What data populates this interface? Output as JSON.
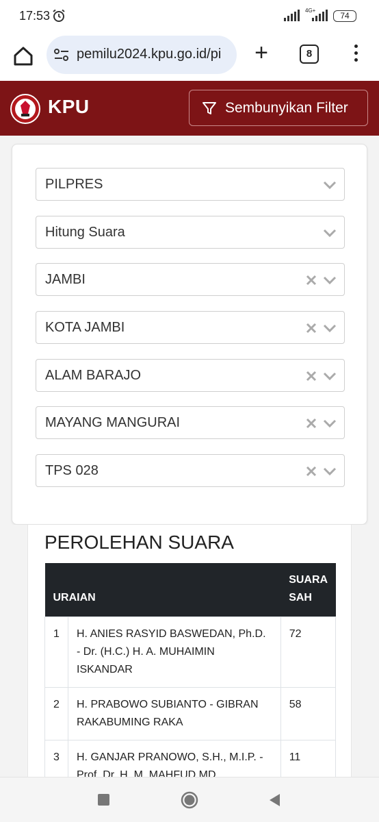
{
  "status_bar": {
    "time": "17:53",
    "network_type": "4G+",
    "battery": "74",
    "icons": [
      "alarm-icon",
      "signal-icon",
      "signal-icon",
      "battery-icon"
    ]
  },
  "browser": {
    "url": "pemilu2024.kpu.go.id/pi",
    "tab_count": "8",
    "icons": [
      "home-icon",
      "site-settings-icon",
      "plus-icon",
      "tabs-icon",
      "more-vert-icon"
    ]
  },
  "header": {
    "title": "KPU",
    "filter_button_label": "Sembunyikan Filter",
    "brand_color": "#7d1416",
    "icons": [
      "kpu-logo",
      "filter-icon"
    ]
  },
  "filters": [
    {
      "value": "PILPRES",
      "clearable": false
    },
    {
      "value": "Hitung Suara",
      "clearable": false
    },
    {
      "value": "JAMBI",
      "clearable": true
    },
    {
      "value": "KOTA JAMBI",
      "clearable": true
    },
    {
      "value": "ALAM BARAJO",
      "clearable": true
    },
    {
      "value": "MAYANG MANGURAI",
      "clearable": true
    },
    {
      "value": "TPS 028",
      "clearable": true
    }
  ],
  "results": {
    "title": "PEROLEHAN SUARA",
    "columns": {
      "uraian": "URAIAN",
      "suara_sah": "SUARA SAH"
    },
    "rows": [
      {
        "no": "1",
        "candidate": "H. ANIES RASYID BASWEDAN, Ph.D. - Dr. (H.C.) H. A. MUHAIMIN ISKANDAR",
        "votes": "72"
      },
      {
        "no": "2",
        "candidate": "H. PRABOWO SUBIANTO - GIBRAN RAKABUMING RAKA",
        "votes": "58"
      },
      {
        "no": "3",
        "candidate": "H. GANJAR PRANOWO, S.H., M.I.P. - Prof. Dr. H. M. MAHFUD MD",
        "votes": "11"
      }
    ],
    "header_color": "#212529"
  },
  "nav_bar": {
    "icons": [
      "recent-apps-icon",
      "home-circle-icon",
      "back-icon"
    ]
  }
}
